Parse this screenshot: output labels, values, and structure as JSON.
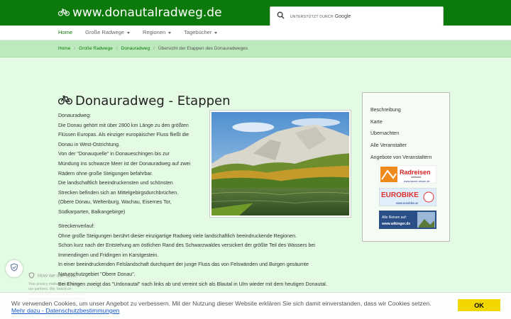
{
  "header": {
    "site_title": "www.donautalradweg.de",
    "search_powered_by": "unterstützt durch",
    "search_brand": "Google"
  },
  "nav": {
    "items": [
      {
        "label": "Home",
        "active": true
      },
      {
        "label": "Große Radwege",
        "dropdown": true
      },
      {
        "label": "Regionen",
        "dropdown": true
      },
      {
        "label": "Tagebücher",
        "dropdown": true
      }
    ]
  },
  "breadcrumb": [
    "Home",
    "Große Radwege",
    "Donauradweg",
    "Übersicht der Etappen des Donauradweges"
  ],
  "main": {
    "title": "Donauradweg - Etappen",
    "intro_lines": [
      "Donauradweg:",
      "Die Donau gehört mit über 2800 km Länge zu den größten",
      "Flüssen Europas. Als einziger europäischer Fluss fließt die",
      "Donau in West-Ostrichtung.",
      "Von der \"Donauquelle\" in Donaueschingen bis zur",
      "Mündung ins schwarze Meer ist der Donauradweg auf zwei",
      "Rädern ohne große Steigungen befahrbar.",
      "Die landschaftlich beeindruckensten und schönsten",
      "Strecken befinden sich an Mittelgebirgsdurchbrüchen.",
      "(Obere Donau, Weltenburg, Wachau, Eisernes Tor,",
      "Südkarparten, Balkangebirge)"
    ],
    "route_lines": [
      "Streckenverlauf:",
      "Ohne große Steigungen berührt dieser einzigartige Radweg viele landschaftlich beeindruckende Regionen.",
      "Schon kurz nach der Entstehung am östlichen Rand des Schwarzwaldes versickert der größte Teil des Wassers bei",
      "Immendingen und Fridingen im Karstgestein.",
      "In einer beeindruckenden Felslandschaft durchquert der junge Fluss das von Felswänden und Burgen gesäumte",
      "Naturschutzgebiet \"Obere Donau\".",
      "Bei Ehingen zweigt das \"Urdonautal\" nach links ab und vereint sich als Blautal in Ulm wieder mit dem heutigen Donautal."
    ]
  },
  "sidebar": {
    "links": [
      "Beschreibung",
      "Karte",
      "Übernachten",
      "Alle Veranstalter",
      "Angebote von Veranstaltern"
    ],
    "ads": [
      {
        "brand": "Radreisen",
        "sub": "weltweit",
        "url": "www.launer-reisen.de"
      },
      {
        "brand": "EUROBIKE",
        "url": "www.eurobike.at"
      },
      {
        "brand": "Alle Reisen auf:",
        "url": "www.wikinger.de"
      }
    ]
  },
  "privacy": {
    "heading": "How we use data",
    "text": "Your privacy matters to us and to our partners. We, based on legitimate interest, and our partners process and share only limited data"
  },
  "cookie": {
    "text": "Wir verwenden Cookies, um unser Angebot zu verbessern. Mit der Nutzung dieser Website erklären Sie sich damit einverstanden, dass wir Cookies setzen.",
    "more_link": "Mehr dazu - Datenschutzbestimmungen",
    "button": "OK"
  },
  "colors": {
    "header_green": "#0b7a0b",
    "page_bg": "#e3fae3",
    "breadcrumb_bg": "#bdeabd",
    "ok_button": "#f1d600"
  }
}
